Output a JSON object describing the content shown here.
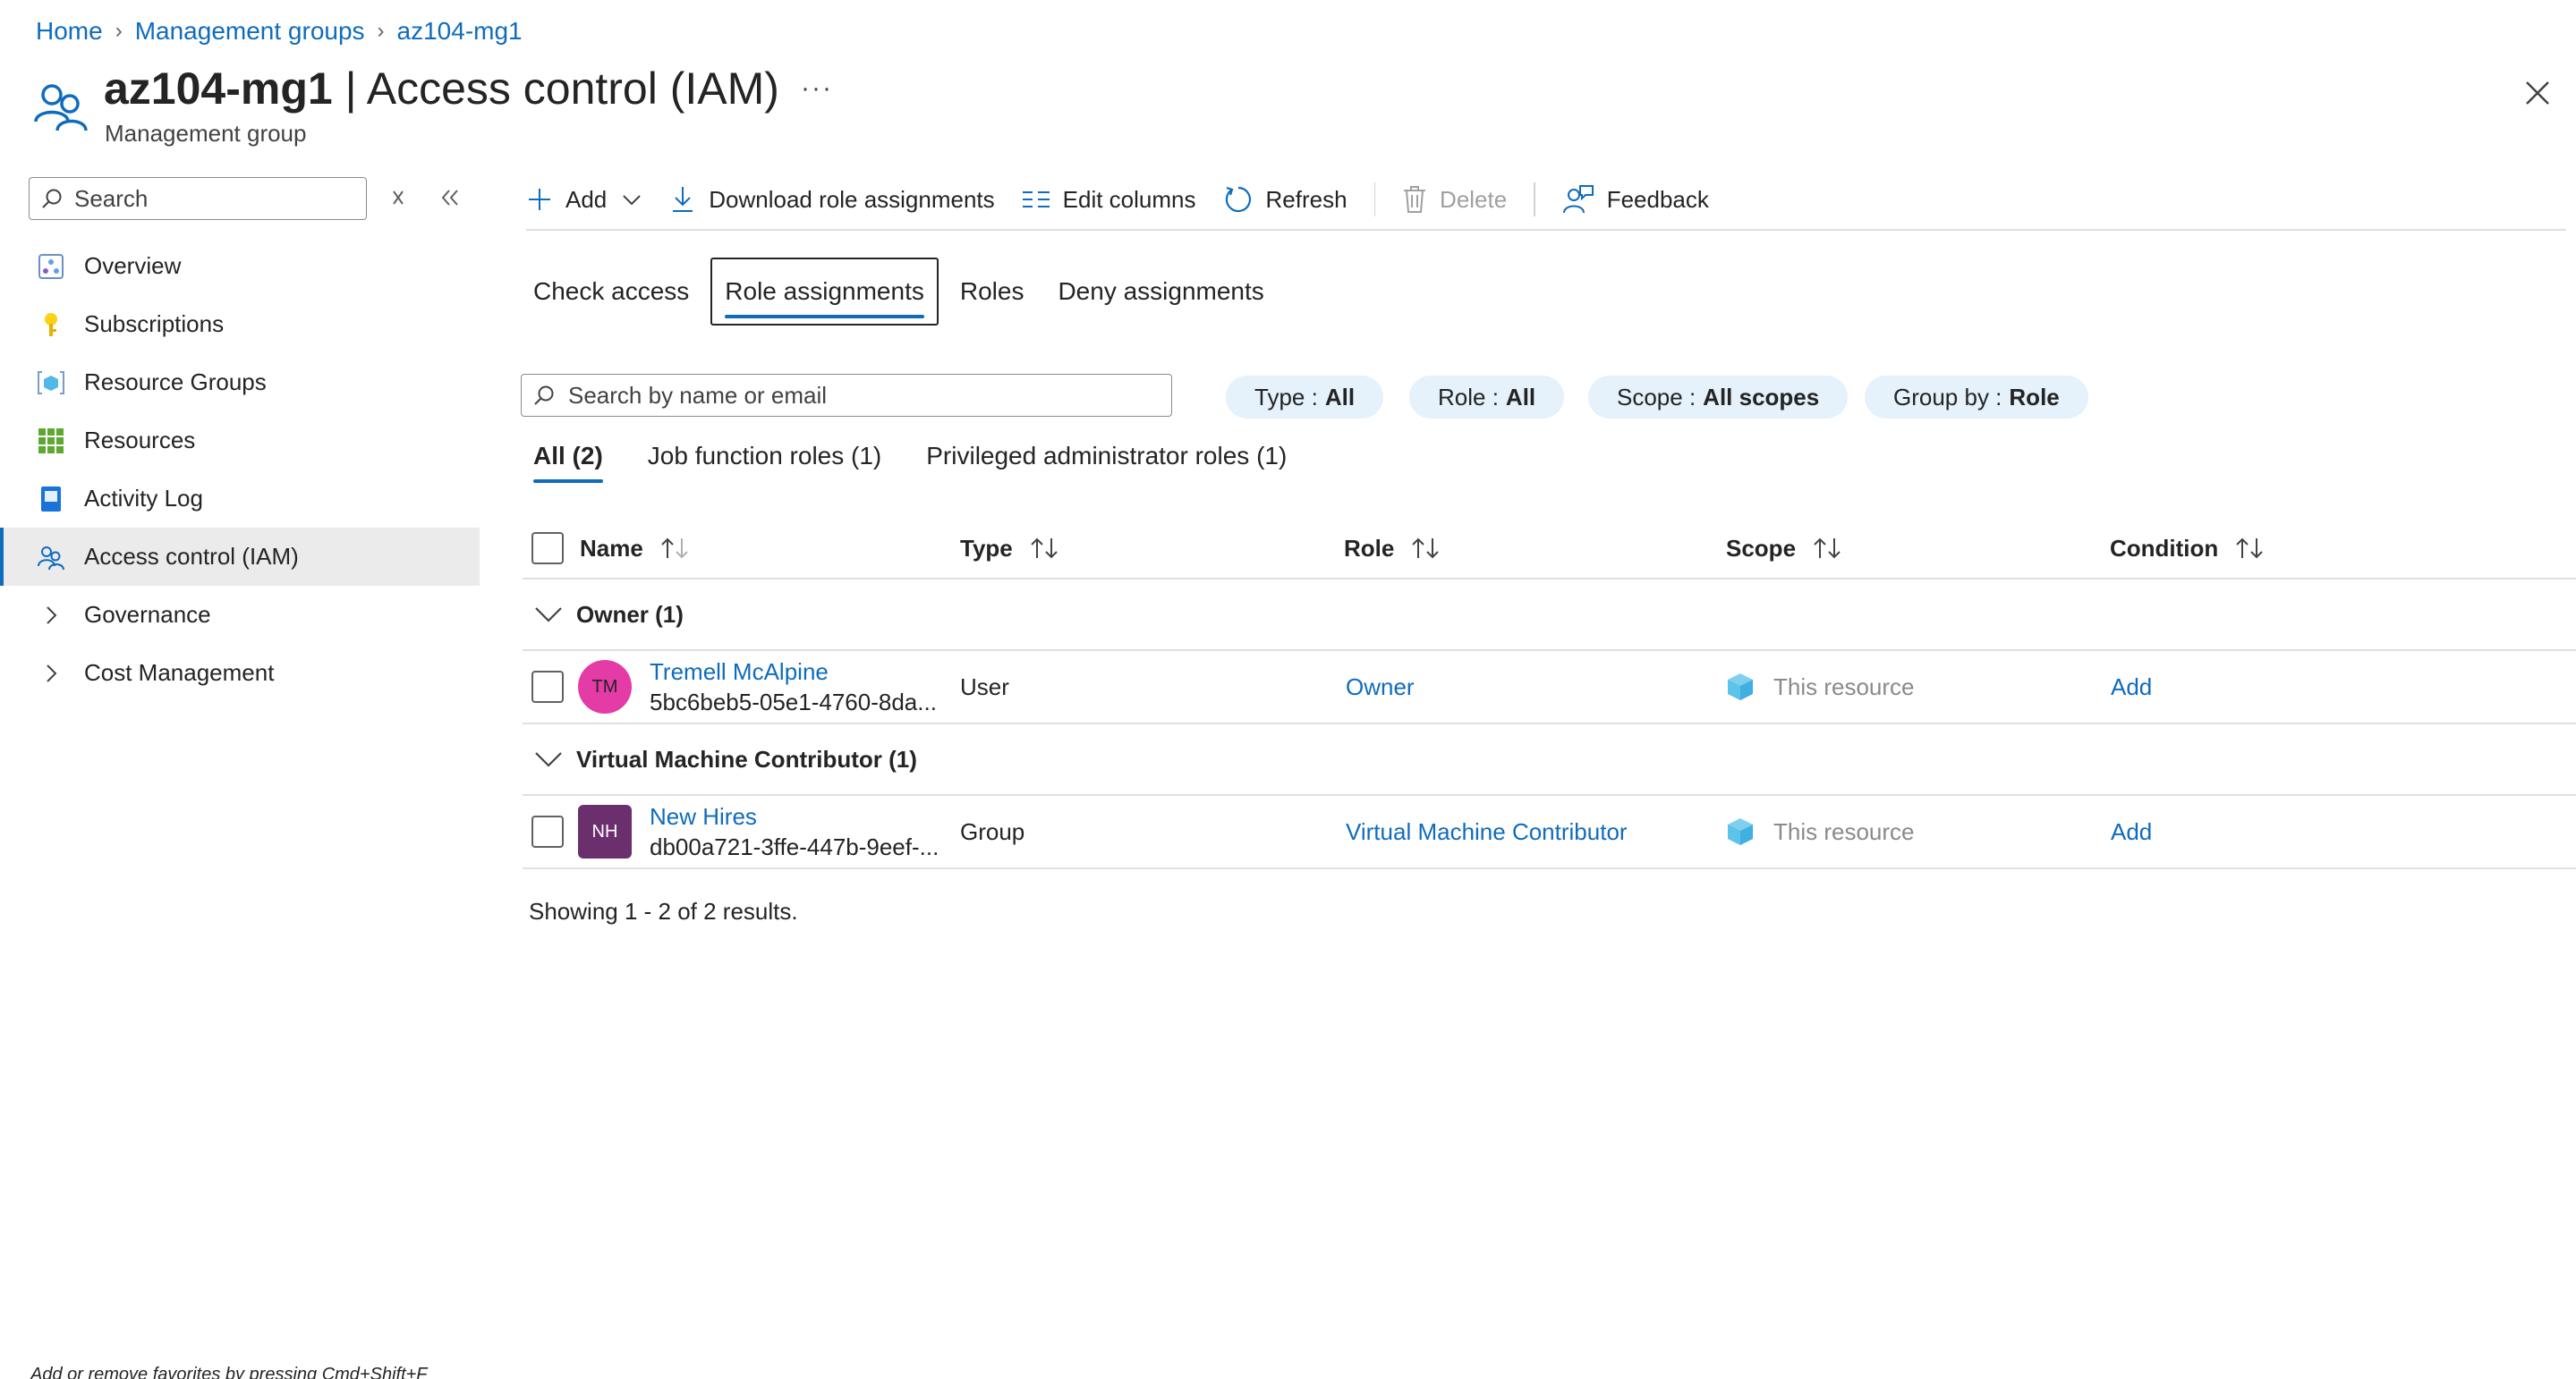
{
  "breadcrumb": {
    "home": "Home",
    "management_groups": "Management groups",
    "current": "az104-mg1"
  },
  "header": {
    "title_bold": "az104-mg1",
    "title_rest": " | Access control (IAM)",
    "subtitle": "Management group",
    "more": "···"
  },
  "sidebar": {
    "search_placeholder": "Search",
    "items": [
      {
        "label": "Overview",
        "icon": "overview-icon"
      },
      {
        "label": "Subscriptions",
        "icon": "key-icon"
      },
      {
        "label": "Resource Groups",
        "icon": "resource-group-icon"
      },
      {
        "label": "Resources",
        "icon": "grid-icon"
      },
      {
        "label": "Activity Log",
        "icon": "log-icon"
      },
      {
        "label": "Access control (IAM)",
        "icon": "people-icon"
      },
      {
        "label": "Governance",
        "icon": "chevron-right-icon"
      },
      {
        "label": "Cost Management",
        "icon": "chevron-right-icon"
      }
    ],
    "footer_hint": "Add or remove favorites by pressing Cmd+Shift+F"
  },
  "toolbar": {
    "add": "Add",
    "download": "Download role assignments",
    "edit_columns": "Edit columns",
    "refresh": "Refresh",
    "delete": "Delete",
    "feedback": "Feedback"
  },
  "tabs": [
    "Check access",
    "Role assignments",
    "Roles",
    "Deny assignments"
  ],
  "search": {
    "placeholder": "Search by name or email"
  },
  "filters": [
    {
      "label": "Type :",
      "value": "All"
    },
    {
      "label": "Role :",
      "value": "All"
    },
    {
      "label": "Scope :",
      "value": "All scopes"
    },
    {
      "label": "Group by :",
      "value": "Role"
    }
  ],
  "subtabs": [
    "All (2)",
    "Job function roles (1)",
    "Privileged administrator roles (1)"
  ],
  "table": {
    "headers": {
      "name": "Name",
      "type": "Type",
      "role": "Role",
      "scope": "Scope",
      "condition": "Condition"
    },
    "groups": [
      {
        "title": "Owner (1)",
        "rows": [
          {
            "initials": "TM",
            "name": "Tremell McAlpine",
            "id": "5bc6beb5-05e1-4760-8da...",
            "type": "User",
            "role": "Owner",
            "scope": "This resource",
            "condition": "Add"
          }
        ]
      },
      {
        "title": "Virtual Machine Contributor (1)",
        "rows": [
          {
            "initials": "NH",
            "name": "New Hires",
            "id": "db00a721-3ffe-447b-9eef-...",
            "type": "Group",
            "role": "Virtual Machine Contributor",
            "scope": "This resource",
            "condition": "Add"
          }
        ]
      }
    ],
    "showing": "Showing 1 - 2 of 2 results."
  },
  "colors": {
    "accent": "#0f6cbd",
    "pill_bg": "#e5f1fb",
    "avatar_tm": "#e43ba6",
    "avatar_nh": "#6b2f6e"
  }
}
